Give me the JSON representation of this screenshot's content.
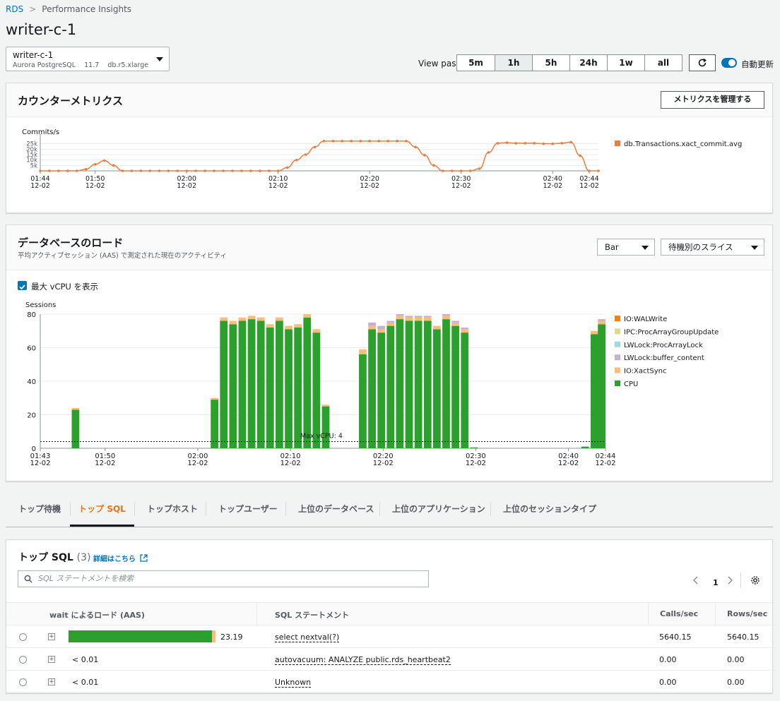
{
  "breadcrumb": {
    "root": "RDS",
    "current": "Performance Insights"
  },
  "page_title": "writer-c-1",
  "instance": {
    "name": "writer-c-1",
    "engine": "Aurora PostgreSQL",
    "version": "11.7",
    "class": "db.r5.xlarge"
  },
  "view_past": {
    "label": "View past",
    "options": [
      "5m",
      "1h",
      "5h",
      "24h",
      "1w",
      "all"
    ],
    "selected": "1h"
  },
  "auto_refresh": {
    "label": "自動更新",
    "enabled": true
  },
  "counter_metrics": {
    "title": "カウンターメトリクス",
    "manage_button": "メトリクスを管理する",
    "chart_data": {
      "type": "line",
      "ylabel": "Commits/s",
      "y_ticks": [
        "25k",
        "20k",
        "15k",
        "10k",
        "5k"
      ],
      "ylim": [
        0,
        30000
      ],
      "x_ticks": [
        {
          "time": "01:44",
          "date": "12-02"
        },
        {
          "time": "01:50",
          "date": "12-02"
        },
        {
          "time": "02:00",
          "date": "12-02"
        },
        {
          "time": "02:10",
          "date": "12-02"
        },
        {
          "time": "02:20",
          "date": "12-02"
        },
        {
          "time": "02:30",
          "date": "12-02"
        },
        {
          "time": "02:40",
          "date": "12-02"
        },
        {
          "time": "02:44",
          "date": "12-02"
        }
      ],
      "series": [
        {
          "name": "db.Transactions.xact_commit.avg",
          "color": "#ec7d3c",
          "x_minutes": [
            0,
            1,
            2,
            3,
            4,
            5,
            6,
            7,
            8,
            9,
            10,
            11,
            12,
            13,
            14,
            15,
            16,
            17,
            18,
            19,
            20,
            21,
            22,
            23,
            24,
            25,
            26,
            27,
            28,
            29,
            30,
            31,
            32,
            33,
            34,
            35,
            36,
            37,
            38,
            39,
            40,
            41,
            42,
            43,
            44,
            45,
            46,
            47,
            48,
            49,
            50,
            51,
            52,
            53,
            54,
            55,
            56,
            57,
            58,
            59,
            60,
            61
          ],
          "values": [
            0,
            0,
            0,
            0,
            0,
            1500,
            6000,
            9500,
            5000,
            0,
            0,
            0,
            0,
            0,
            0,
            0,
            0,
            0,
            0,
            0,
            0,
            0,
            0,
            0,
            0,
            0,
            0,
            3000,
            10000,
            15000,
            22000,
            27500,
            27500,
            27500,
            27500,
            27500,
            27500,
            27500,
            27500,
            27500,
            27500,
            22000,
            14500,
            5000,
            0,
            0,
            0,
            0,
            2000,
            17000,
            25500,
            26000,
            25500,
            25500,
            25500,
            25000,
            25000,
            25500,
            26500,
            14000,
            0,
            0
          ]
        }
      ]
    }
  },
  "db_load": {
    "title": "データベースのロード",
    "subtitle": "平均アクティブセッション (AAS) で測定された現在のアクティビティ",
    "chart_select": "Bar",
    "slice_select": "待機別のスライス",
    "show_vcpu_label": "最大 vCPU を表示",
    "chart_data": {
      "type": "bar",
      "stacked": true,
      "ylabel": "Sessions",
      "ylim": [
        0,
        80
      ],
      "y_ticks": [
        0,
        20,
        40,
        60,
        80
      ],
      "max_vcpu_label": "Max vCPU: 4",
      "max_vcpu": 4,
      "x_ticks": [
        {
          "time": "01:43",
          "date": "12-02"
        },
        {
          "time": "01:50",
          "date": "12-02"
        },
        {
          "time": "02:00",
          "date": "12-02"
        },
        {
          "time": "02:10",
          "date": "12-02"
        },
        {
          "time": "02:20",
          "date": "12-02"
        },
        {
          "time": "02:30",
          "date": "12-02"
        },
        {
          "time": "02:40",
          "date": "12-02"
        },
        {
          "time": "02:44",
          "date": "12-02"
        }
      ],
      "legend": [
        {
          "name": "IO:WALWrite",
          "color": "#ff7f0e"
        },
        {
          "name": "IPC:ProcArrayGroupUpdate",
          "color": "#dbdb8d"
        },
        {
          "name": "LWLock:ProcArrayLock",
          "color": "#9edae5"
        },
        {
          "name": "LWLock:buffer_content",
          "color": "#c5b0d5"
        },
        {
          "name": "IO:XactSync",
          "color": "#ffbb78"
        },
        {
          "name": "CPU",
          "color": "#2ca02c"
        }
      ],
      "bars": [
        {
          "minute": 4,
          "cpu": 23,
          "xact": 1,
          "buf": 0
        },
        {
          "minute": 19,
          "cpu": 29,
          "xact": 1,
          "buf": 0
        },
        {
          "minute": 20,
          "cpu": 76,
          "xact": 2,
          "buf": 0
        },
        {
          "minute": 21,
          "cpu": 74,
          "xact": 2,
          "buf": 0
        },
        {
          "minute": 22,
          "cpu": 76,
          "xact": 2,
          "buf": 0
        },
        {
          "minute": 23,
          "cpu": 77,
          "xact": 2,
          "buf": 0
        },
        {
          "minute": 24,
          "cpu": 76,
          "xact": 2,
          "buf": 0
        },
        {
          "minute": 25,
          "cpu": 72,
          "xact": 2,
          "buf": 0
        },
        {
          "minute": 26,
          "cpu": 76,
          "xact": 2,
          "buf": 0
        },
        {
          "minute": 27,
          "cpu": 71,
          "xact": 2,
          "buf": 0
        },
        {
          "minute": 28,
          "cpu": 72,
          "xact": 2,
          "buf": 0
        },
        {
          "minute": 29,
          "cpu": 78,
          "xact": 2,
          "buf": 0
        },
        {
          "minute": 30,
          "cpu": 69,
          "xact": 2,
          "buf": 0
        },
        {
          "minute": 31,
          "cpu": 25,
          "xact": 1,
          "buf": 0
        },
        {
          "minute": 35,
          "cpu": 56,
          "xact": 3,
          "buf": 0
        },
        {
          "minute": 36,
          "cpu": 71,
          "xact": 2,
          "buf": 2
        },
        {
          "minute": 37,
          "cpu": 69,
          "xact": 2,
          "buf": 2
        },
        {
          "minute": 38,
          "cpu": 73,
          "xact": 2,
          "buf": 1
        },
        {
          "minute": 39,
          "cpu": 77,
          "xact": 2,
          "buf": 1
        },
        {
          "minute": 40,
          "cpu": 76,
          "xact": 2,
          "buf": 1
        },
        {
          "minute": 41,
          "cpu": 76,
          "xact": 2,
          "buf": 1
        },
        {
          "minute": 42,
          "cpu": 76,
          "xact": 2,
          "buf": 1
        },
        {
          "minute": 43,
          "cpu": 71,
          "xact": 2,
          "buf": 0
        },
        {
          "minute": 44,
          "cpu": 77,
          "xact": 2,
          "buf": 1
        },
        {
          "minute": 45,
          "cpu": 73,
          "xact": 2,
          "buf": 1
        },
        {
          "minute": 46,
          "cpu": 69,
          "xact": 2,
          "buf": 1
        },
        {
          "minute": 47,
          "cpu": 0.5,
          "xact": 0,
          "buf": 0
        },
        {
          "minute": 59,
          "cpu": 1,
          "xact": 0,
          "buf": 0
        },
        {
          "minute": 60,
          "cpu": 68,
          "xact": 2,
          "buf": 0
        },
        {
          "minute": 61,
          "cpu": 74,
          "xact": 2,
          "buf": 1
        }
      ]
    }
  },
  "tabs": [
    "トップ待機",
    "トップ SQL",
    "トップホスト",
    "トップユーザー",
    "上位のデータベース",
    "上位のアプリケーション",
    "上位のセッションタイプ"
  ],
  "active_tab": "トップ SQL",
  "top_sql": {
    "title": "トップ SQL",
    "count": "(3)",
    "details_link": "詳細はこちら",
    "search_placeholder": "SQL ステートメントを検索",
    "page": "1",
    "columns": [
      "wait によるロード (AAS)",
      "SQL ステートメント",
      "Calls/sec",
      "Rows/sec"
    ],
    "rows": [
      {
        "load": "23.19",
        "load_fraction": 0.86,
        "sql": "select nextval(?)",
        "calls": "5640.15",
        "rows": "5640.15"
      },
      {
        "load": "< 0.01",
        "load_fraction": 0,
        "sql": "autovacuum: ANALYZE public.rds_heartbeat2",
        "calls": "0.00",
        "rows": "0.00"
      },
      {
        "load": "< 0.01",
        "load_fraction": 0,
        "sql": "Unknown",
        "calls": "0.00",
        "rows": "0.00"
      }
    ]
  }
}
